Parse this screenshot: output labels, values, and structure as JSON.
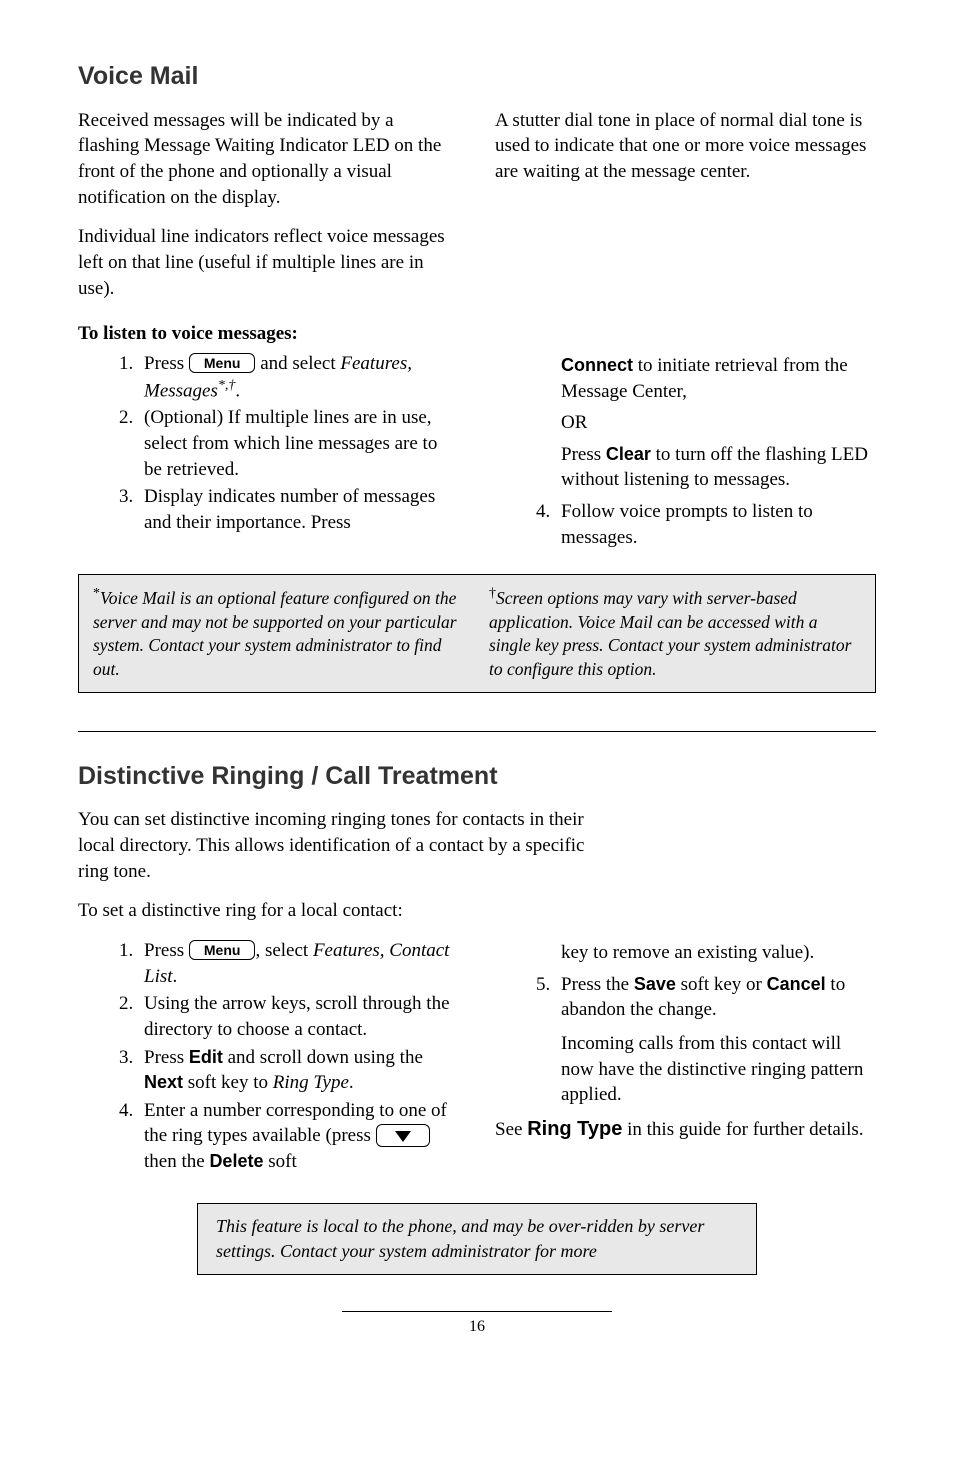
{
  "vm": {
    "heading": "Voice Mail",
    "p1": "Received messages will be indicated by a flashing Message Waiting Indicator LED on the front of the phone and optionally a visual notification on the display.",
    "p2": "Individual line indicators reflect voice messages left on that line (useful if multiple lines are in use).",
    "p3": "A stutter dial tone in place of normal dial tone is used to indicate that one or more voice messages are waiting at the message center.",
    "subhead": "To listen to voice messages:",
    "s1_a": "Press ",
    "s1_key": "Menu",
    "s1_b": " and select ",
    "s1_c": "Features, Messages",
    "s1_sup": "*,†",
    "s1_d": ".",
    "s2": "(Optional)  If multiple lines are in use, select from which line messages are to be retrieved.",
    "s3": "Display indicates number of messages and their importance.  Press",
    "s3b_a": " to initiate retrieval from the Message Center,",
    "s3b_connect": "Connect",
    "or": "OR",
    "s3c_a": "Press ",
    "s3c_clear": "Clear",
    "s3c_b": " to turn off the flashing LED without listening to messages.",
    "s4": "Follow voice prompts to listen to messages.",
    "note_l_sym": "*",
    "note_l": "Voice Mail is an optional feature configured on the server and may not be supported on your particular system.  Contact your system administrator to find out.",
    "note_r_sym": "†",
    "note_r": "Screen options may vary with server-based application.  Voice Mail can be accessed with a single key press.  Contact your system administrator to configure this option."
  },
  "dr": {
    "heading": "Distinctive Ringing / Call Treatment",
    "p1": "You can set distinctive incoming ringing tones for contacts in their local directory.  This allows identification of a contact by a specific ring tone.",
    "p2": "To set a distinctive ring for a local contact:",
    "s1_a": "Press ",
    "s1_key": "Menu",
    "s1_b": ", select ",
    "s1_c": "Features, Contact List",
    "s1_d": ".",
    "s2": "Using the arrow keys, scroll through the directory to choose a contact.",
    "s3_a": "Press ",
    "s3_edit": "Edit",
    "s3_b": " and scroll down using the ",
    "s3_next": "Next",
    "s3_c": " soft key to ",
    "s3_d": "Ring Type",
    "s3_e": ".",
    "s4_a": "Enter a number corresponding to one of the ring types available (press ",
    "s4_b": " then the ",
    "s4_del": "Delete",
    "s4_c": " soft",
    "s4_tail": "key to remove an existing value).",
    "s5_a": "Press the ",
    "s5_save": "Save",
    "s5_b": " soft key or ",
    "s5_cancel": "Cancel",
    "s5_c": " to abandon the change.",
    "r_p": "Incoming calls from this contact will now have the distinctive ringing pattern applied.",
    "see_a": "See ",
    "see_bold": "Ring Type",
    "see_b": " in this guide for further details.",
    "note": "This feature is local to the phone, and may be over-ridden by server settings.  Contact your system administrator for more"
  },
  "pagenum": "16"
}
